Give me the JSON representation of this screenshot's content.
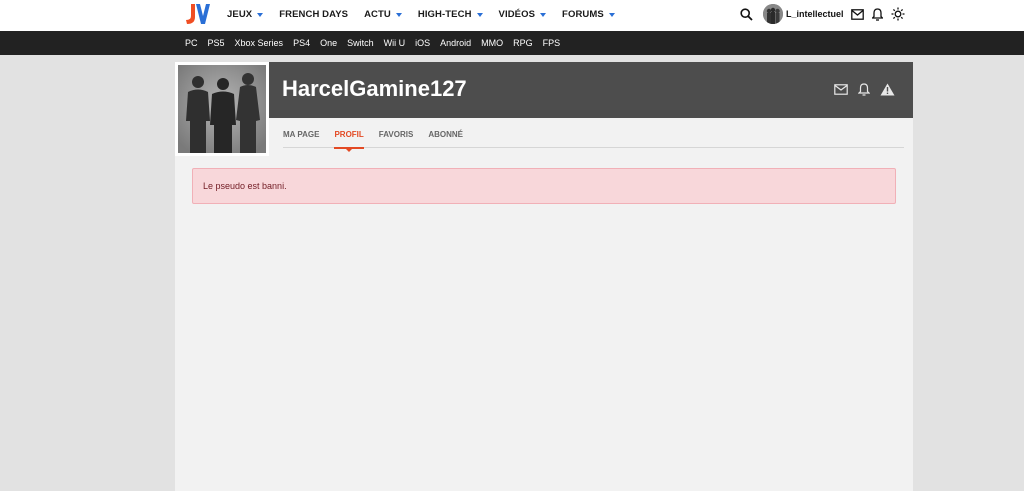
{
  "topnav": {
    "logo_icon": "jv-logo",
    "menu": [
      {
        "label": "JEUX",
        "has_dropdown": true
      },
      {
        "label": "FRENCH DAYS",
        "has_dropdown": false
      },
      {
        "label": "ACTU",
        "has_dropdown": true
      },
      {
        "label": "HIGH-TECH",
        "has_dropdown": true
      },
      {
        "label": "VIDÉOS",
        "has_dropdown": true
      },
      {
        "label": "FORUMS",
        "has_dropdown": true
      }
    ],
    "username": "L_intellectuel",
    "icons": [
      "search-icon",
      "mail-icon",
      "bell-icon",
      "sun-icon"
    ]
  },
  "platforms": [
    "PC",
    "PS5",
    "Xbox Series",
    "PS4",
    "One",
    "Switch",
    "Wii U",
    "iOS",
    "Android",
    "MMO",
    "RPG",
    "FPS"
  ],
  "profile": {
    "name": "HarcelGamine127",
    "banner_icons": [
      "mail-icon",
      "bell-icon",
      "warning-icon"
    ],
    "tabs": [
      {
        "label": "MA PAGE",
        "active": false
      },
      {
        "label": "PROFIL",
        "active": true
      },
      {
        "label": "FAVORIS",
        "active": false
      },
      {
        "label": "ABONNÉ",
        "active": false
      }
    ]
  },
  "alert": {
    "message": "Le pseudo est banni."
  },
  "colors": {
    "accent": "#e34a24",
    "banner": "#4d4d4d",
    "alert_bg": "#f8d7da",
    "alert_text": "#721c24",
    "platform_bar": "#222222"
  }
}
